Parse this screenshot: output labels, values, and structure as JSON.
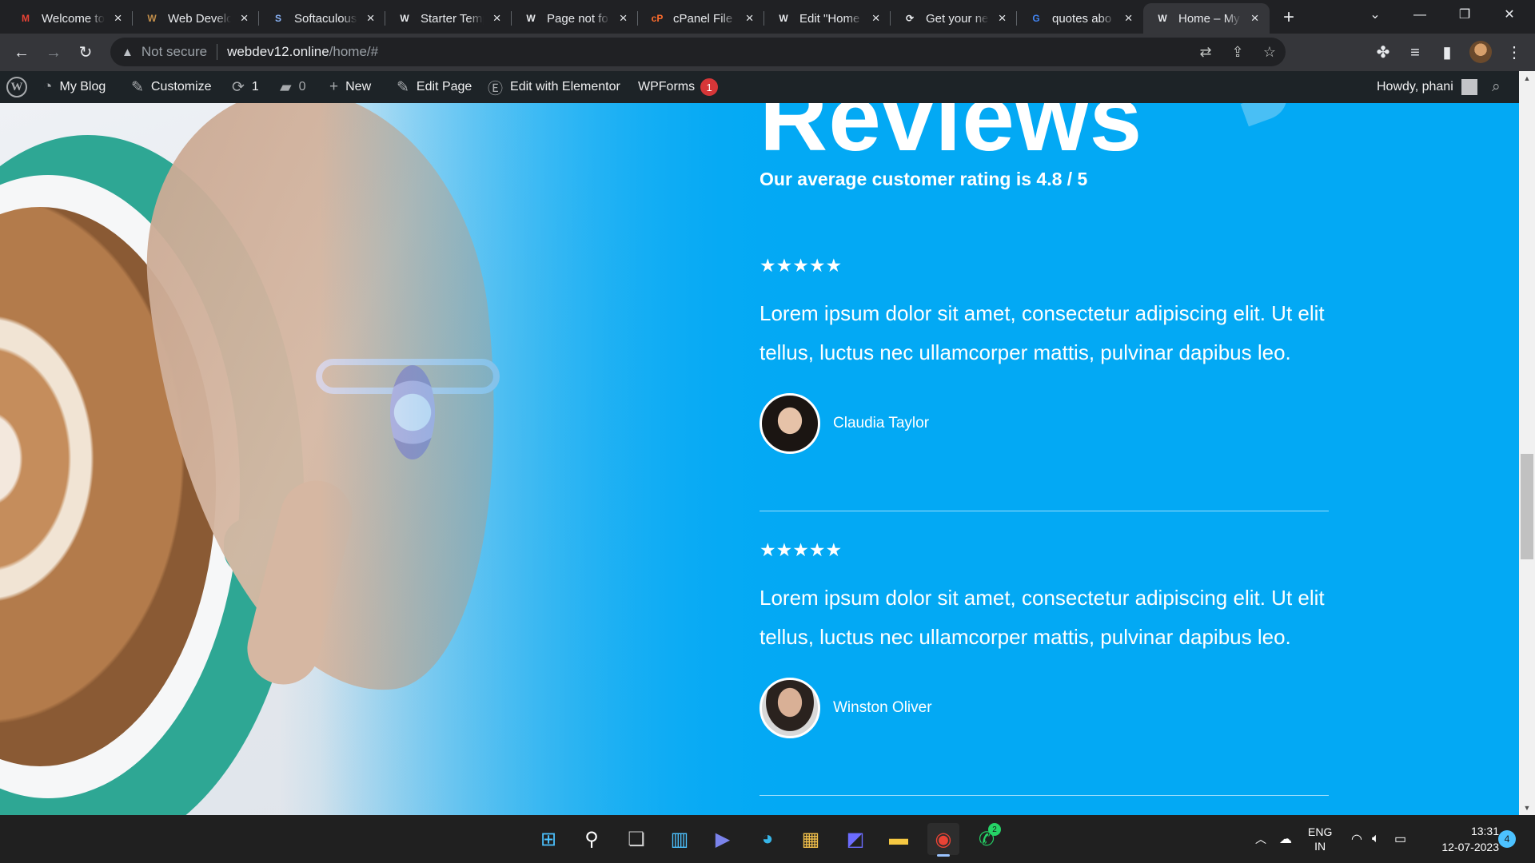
{
  "browser": {
    "tabs": [
      {
        "title": "Welcome to",
        "favicon": "gmail-icon",
        "fav_text": "M",
        "fav_color": "#ea4335"
      },
      {
        "title": "Web Develo",
        "favicon": "site-icon",
        "fav_text": "W",
        "fav_color": "#c28e4a"
      },
      {
        "title": "Softaculous",
        "favicon": "softaculous-icon",
        "fav_text": "S",
        "fav_color": "#8ab4f8"
      },
      {
        "title": "Starter Temp",
        "favicon": "wordpress-icon",
        "fav_text": "W",
        "fav_color": "#e8eaed"
      },
      {
        "title": "Page not fo",
        "favicon": "wordpress-icon",
        "fav_text": "W",
        "fav_color": "#e8eaed"
      },
      {
        "title": "cPanel File M",
        "favicon": "cpanel-icon",
        "fav_text": "cP",
        "fav_color": "#ff6c2c"
      },
      {
        "title": "Edit \"Home",
        "favicon": "wordpress-icon",
        "fav_text": "W",
        "fav_color": "#e8eaed"
      },
      {
        "title": "Get your ne",
        "favicon": "chatgpt-icon",
        "fav_text": "⟳",
        "fav_color": "#e8eaed"
      },
      {
        "title": "quotes abo",
        "favicon": "google-icon",
        "fav_text": "G",
        "fav_color": "#4285f4"
      },
      {
        "title": "Home – My",
        "favicon": "wordpress-icon",
        "fav_text": "W",
        "fav_color": "#e8eaed",
        "active": true
      }
    ],
    "close_glyph": "×",
    "newtab_glyph": "+",
    "address": {
      "security": "Not secure",
      "host": "webdev12.online",
      "path": "/home/#"
    }
  },
  "adminbar": {
    "wp_logo": "W",
    "my_blog": "My Blog",
    "customize": "Customize",
    "updates_count": "1",
    "comments_count": "0",
    "new": "New",
    "edit_page": "Edit Page",
    "edit_elementor": "Edit with Elementor",
    "wpforms": "WPForms",
    "wpforms_badge": "1",
    "howdy": "Howdy, phani"
  },
  "content": {
    "heading": "Reviews",
    "subheading": "Our average customer rating is 4.8 / 5",
    "reviews": [
      {
        "rating": 5,
        "stars": "★★★★★",
        "text": "Lorem ipsum dolor sit amet, consectetur adipiscing elit. Ut elit tellus, luctus nec ullamcorper mattis, pulvinar dapibus leo.",
        "author": "Claudia Taylor"
      },
      {
        "rating": 5,
        "stars": "★★★★★",
        "text": "Lorem ipsum dolor sit amet, consectetur adipiscing elit. Ut elit tellus, luctus nec ullamcorper mattis, pulvinar dapibus leo.",
        "author": "Winston Oliver"
      }
    ],
    "accent_color": "#03a9f4"
  },
  "taskbar": {
    "apps": [
      "start-icon",
      "search-icon",
      "task-view-icon",
      "widgets-icon",
      "teams-icon",
      "edge-icon",
      "store-icon",
      "app-icon",
      "file-explorer-icon",
      "chrome-icon",
      "whatsapp-icon"
    ],
    "whatsapp_badge": "2",
    "lang_line1": "ENG",
    "lang_line2": "IN",
    "time": "13:31",
    "date": "12-07-2023",
    "notifications": "4"
  }
}
